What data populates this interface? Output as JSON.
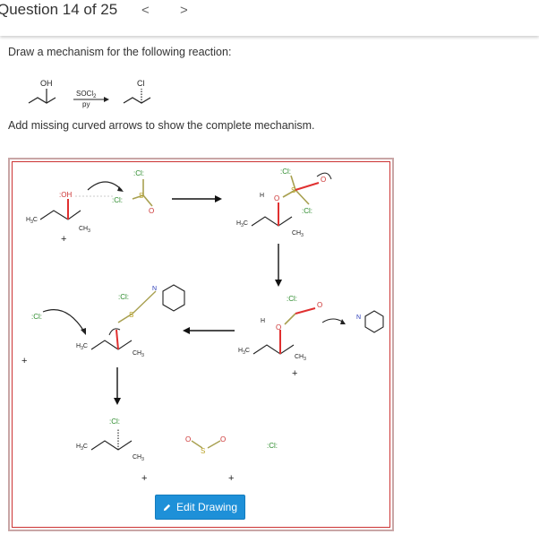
{
  "header": {
    "question_label": "Question 14 of 25",
    "prev_glyph": "<",
    "next_glyph": ">"
  },
  "question": {
    "prompt": "Draw a mechanism for the following reaction:",
    "instruction": "Add missing curved arrows to show the complete mechanism."
  },
  "reaction": {
    "reactant_group": "OH",
    "reagent": "SOCl",
    "reagent_sub": "2",
    "solvent": "py",
    "product_group": "Cl"
  },
  "mechanism": {
    "oh": ":OH",
    "cl_lone": ":Cl:",
    "s": "S",
    "h3c": "H",
    "h3c_sub": "3",
    "ch3": "CH",
    "ch3_sub": "3",
    "c_label": "C",
    "h": "H",
    "o": "O",
    "n": "N",
    "plus": "+",
    "cl_minus": ":Cl:",
    "o_label": "O",
    "s_label": "S"
  },
  "edit_button": {
    "label": "Edit Drawing"
  },
  "colors": {
    "accent_blue": "#1e90d8",
    "frame_red": "#cc3333",
    "bond_red": "#e03030",
    "bond_olive": "#a8a050"
  }
}
